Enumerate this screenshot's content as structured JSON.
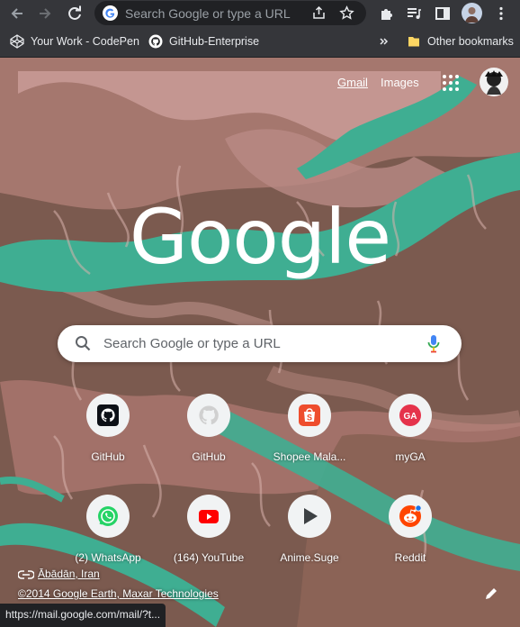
{
  "toolbar": {
    "omnibox_placeholder": "Search Google or type a URL"
  },
  "bookmarks": [
    {
      "label": "Your Work - CodePen",
      "icon": "codepen-icon"
    },
    {
      "label": "GitHub-Enterprise",
      "icon": "github-icon"
    }
  ],
  "other_bookmarks": "Other bookmarks",
  "top_links": {
    "gmail": "Gmail",
    "images": "Images"
  },
  "logo_text": "Google",
  "search": {
    "placeholder": "Search Google or type a URL"
  },
  "shortcuts": [
    {
      "label": "GitHub",
      "icon": "github-icon"
    },
    {
      "label": "GitHub",
      "icon": "github-icon"
    },
    {
      "label": "Shopee Mala...",
      "icon": "shopee-icon"
    },
    {
      "label": "myGA",
      "icon": "ga-icon"
    },
    {
      "label": "(2) WhatsApp",
      "icon": "whatsapp-icon"
    },
    {
      "label": "(164) YouTube",
      "icon": "youtube-icon"
    },
    {
      "label": "Anime.Suge",
      "icon": "play-icon"
    },
    {
      "label": "Reddit",
      "icon": "reddit-icon"
    }
  ],
  "attribution": {
    "location": "Ābādān, Iran",
    "copyright": "©2014 Google Earth, Maxar Technologies"
  },
  "status_url": "https://mail.google.com/mail/?t...",
  "colors": {
    "toolbar": "#35363a",
    "omnibox": "#202124",
    "water": "#3fae92",
    "land": "#7e5b4f",
    "land_light": "#c79a93"
  }
}
